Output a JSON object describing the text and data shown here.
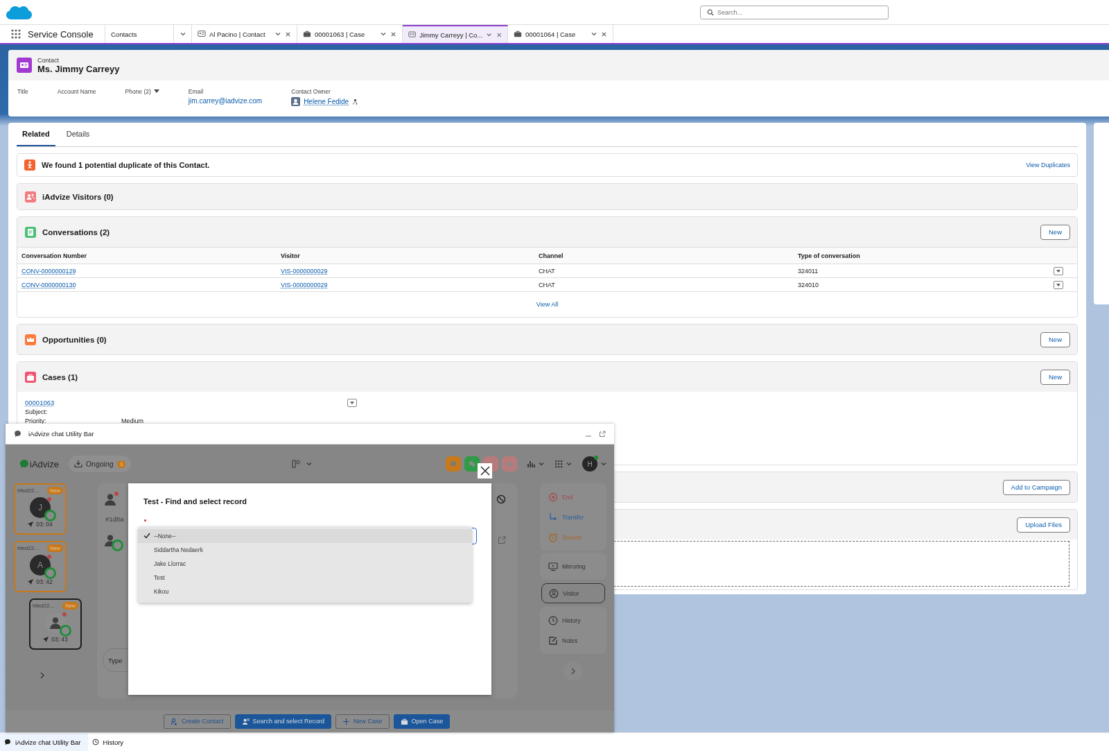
{
  "header": {
    "search": {
      "placeholder": "Search..."
    }
  },
  "nav": {
    "app_name": "Service Console",
    "tabs": [
      {
        "kind": "list",
        "label": "Contacts",
        "selected": false
      },
      {
        "kind": "contact",
        "label": "Al Pacino | Contact",
        "selected": false
      },
      {
        "kind": "case",
        "label": "00001063 | Case",
        "selected": false
      },
      {
        "kind": "contact",
        "label": "Jimmy Carreyy | Co...",
        "selected": true
      },
      {
        "kind": "case",
        "label": "00001064 | Case",
        "selected": false
      }
    ]
  },
  "record": {
    "object_type": "Contact",
    "name": "Ms. Jimmy Carreyy",
    "fields": [
      {
        "kind": "plain",
        "label": "Title"
      },
      {
        "kind": "plain",
        "label": "Account Name"
      },
      {
        "kind": "dropdown",
        "label": "Phone (2)"
      },
      {
        "kind": "link",
        "label": "Email",
        "value": "jim.carrey@iadvize.com"
      },
      {
        "kind": "owner",
        "label": "Contact Owner",
        "value": "Helene Fedide"
      }
    ]
  },
  "related_tabs": [
    {
      "label": "Related",
      "selected": true
    },
    {
      "label": "Details",
      "selected": false
    }
  ],
  "duplicate_alert": {
    "color": "#f4622d",
    "text": "We found 1 potential duplicate of this Contact.",
    "action": "View Duplicates"
  },
  "related_lists": [
    {
      "kind": "visitors",
      "title": "iAdvize Visitors (0)",
      "color": "#f17b7e"
    },
    {
      "kind": "conversations",
      "title": "Conversations (2)",
      "color": "#4bc076",
      "button": "New",
      "columns": [
        "Conversation Number",
        "Visitor",
        "Channel",
        "Type of conversation"
      ],
      "rows": [
        {
          "cells": [
            "CONV-0000000129",
            "VIS-0000000029",
            "CHAT",
            "324011"
          ]
        },
        {
          "cells": [
            "CONV-0000000130",
            "VIS-0000000029",
            "CHAT",
            "324010"
          ]
        }
      ],
      "footer": "View All"
    },
    {
      "kind": "opportunities",
      "title": "Opportunities (0)",
      "color": "#fc7a3c",
      "button": "New"
    },
    {
      "kind": "cases",
      "title": "Cases (1)",
      "color": "#f2536e",
      "button": "New",
      "records": [
        {
          "number": "00001063",
          "fields": [
            {
              "label": "Subject:"
            },
            {
              "label": "Priority:",
              "value": "Medium"
            }
          ]
        }
      ]
    },
    {
      "kind": "campaigns",
      "button": "Add to Campaign"
    },
    {
      "kind": "files",
      "button": "Upload Files"
    }
  ],
  "utility_panel": {
    "title": "iAdvize chat Utility Bar"
  },
  "iadvize": {
    "brand": "iAdvize",
    "ongoing": {
      "label": "Ongoing",
      "count": "3"
    },
    "header_actions": [
      {
        "kind": "chat",
        "color": "#c8791a"
      },
      {
        "kind": "message",
        "color": "#2f9a47"
      },
      {
        "kind": "call",
        "color": "#b77b7b"
      },
      {
        "kind": "video",
        "color": "#b77b7b"
      }
    ],
    "agent_initial": "H",
    "conversations": [
      {
        "kind": "initial",
        "name": "hfed22...",
        "badge": "New",
        "initial": "J",
        "time": "03: 04",
        "selected": false
      },
      {
        "kind": "initial",
        "name": "hfed22...",
        "badge": "New",
        "initial": "A",
        "time": "03: 42",
        "selected": false
      },
      {
        "kind": "anonymous",
        "name": "hfed22...",
        "badge": "New",
        "time": "03: 43",
        "selected": true
      }
    ],
    "chat": {
      "visitor_id": "#1d8a",
      "input": {
        "placeholder": "Type"
      }
    },
    "action_groups": [
      {
        "items": [
          {
            "kind": "end",
            "label": "End",
            "selected": false
          },
          {
            "kind": "transfer",
            "label": "Transfer",
            "selected": false
          },
          {
            "kind": "snooze",
            "label": "Snooze",
            "selected": false
          }
        ]
      },
      {
        "items": [
          {
            "kind": "mirroring",
            "label": "Mirroring",
            "selected": false
          }
        ]
      },
      {
        "items": [
          {
            "kind": "visitor",
            "label": "Visitor",
            "selected": true
          }
        ]
      },
      {
        "items": [
          {
            "kind": "history",
            "label": "History",
            "selected": false
          },
          {
            "kind": "notes",
            "label": "Notes",
            "selected": false
          }
        ]
      }
    ],
    "footer_buttons": [
      {
        "kind": "create_contact",
        "label": "Create Contact",
        "primary": false
      },
      {
        "kind": "search_record",
        "label": "Search and select Record",
        "primary": true
      },
      {
        "kind": "new_case",
        "label": "New Case",
        "primary": false
      },
      {
        "kind": "open_case",
        "label": "Open Case",
        "primary": true
      }
    ]
  },
  "modal": {
    "title": "Test - Find and select record",
    "required": true,
    "options": [
      {
        "label": "--None--",
        "selected": true
      },
      {
        "label": "Siddartha Nedaerk",
        "selected": false
      },
      {
        "label": "Jake Llorrac",
        "selected": false
      },
      {
        "label": "Test",
        "selected": false
      },
      {
        "label": "Kikou",
        "selected": false
      }
    ]
  },
  "utility_bar": {
    "items": [
      {
        "kind": "chat",
        "label": "iAdvize chat Utility Bar",
        "selected": true
      },
      {
        "kind": "history",
        "label": "History",
        "selected": false
      }
    ]
  }
}
